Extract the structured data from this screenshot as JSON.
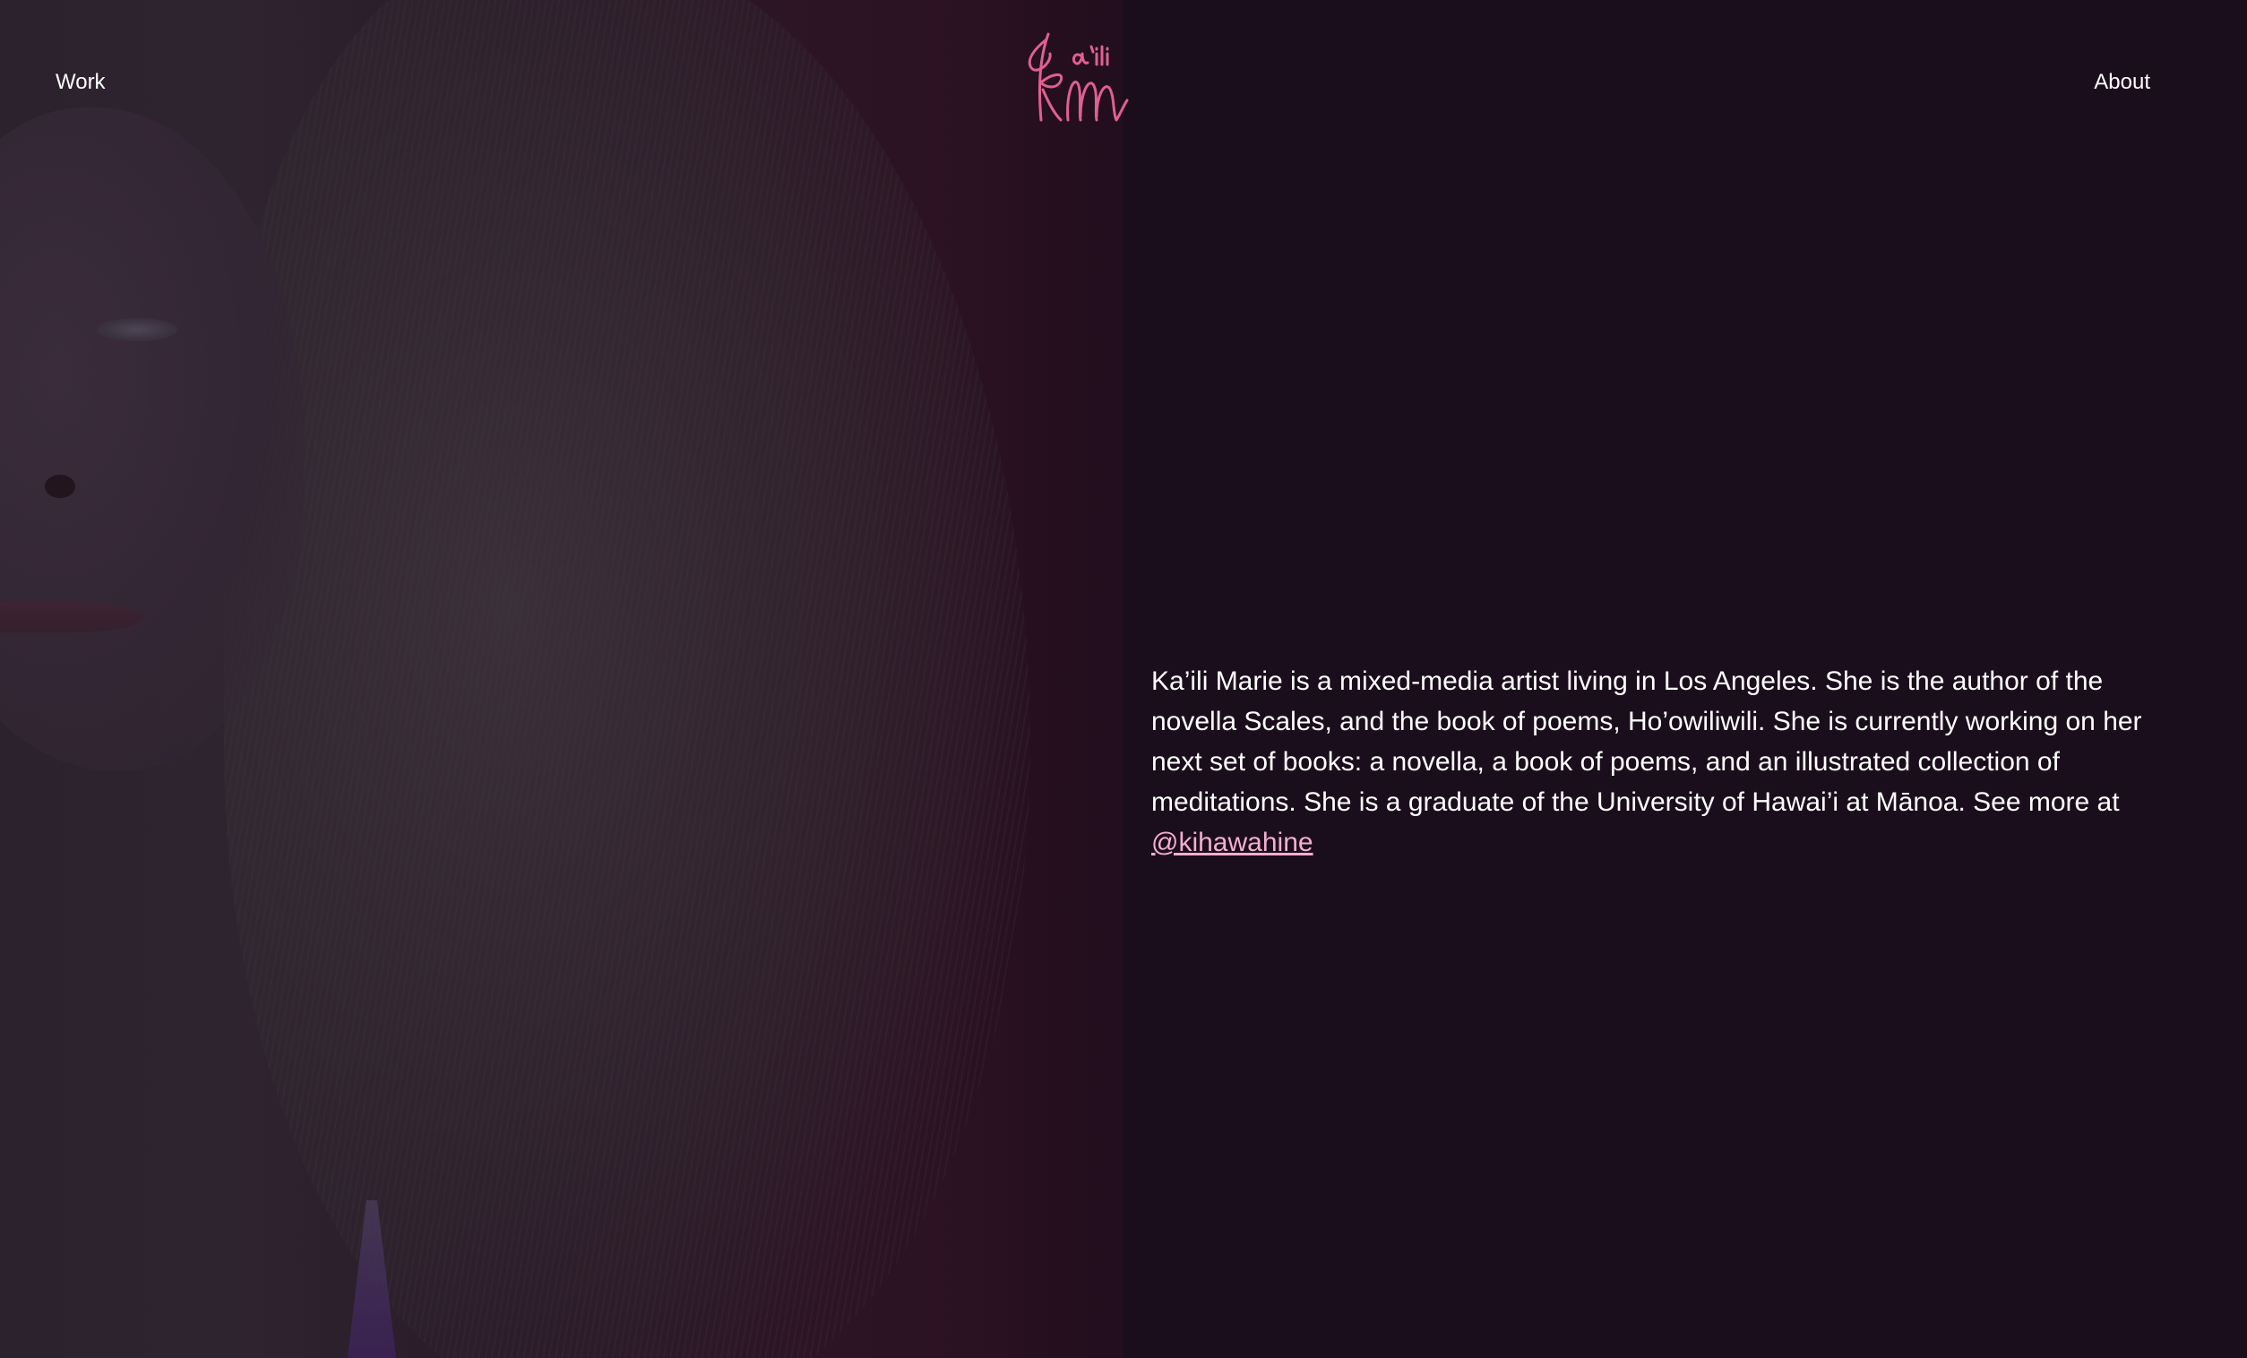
{
  "header": {
    "nav_left_label": "Work",
    "nav_right_label": "About",
    "logo_text": "ka'ili Kim"
  },
  "bio": {
    "text": "Ka’ili Marie is a mixed-media artist living in Los Angeles. She is the author of the novella Scales, and the book of poems, Ho’owiliwili. She is currently working on her next set of books: a novella, a book of poems, and an illustrated collection of meditations. She is a graduate of the University of Hawai’i at Mānoa. See more at ",
    "link_label": "@kihawahine"
  },
  "colors": {
    "background": "#1b0e1c",
    "accent_pink": "#e0608f",
    "link_pink": "#f4aed0",
    "text": "#ffffff"
  },
  "icons": {
    "logo": "signature-logo"
  }
}
